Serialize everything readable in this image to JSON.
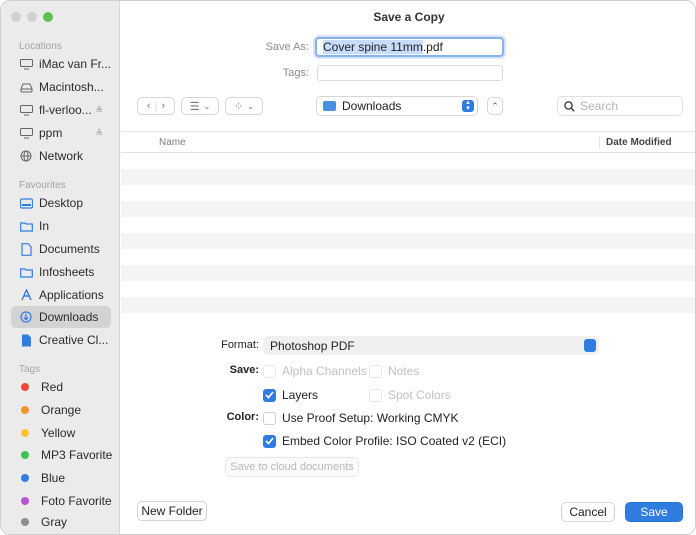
{
  "window": {
    "title": "Save a Copy"
  },
  "sidebar": {
    "locations_header": "Locations",
    "locations": [
      {
        "label": "iMac van Fr...",
        "icon": "display-icon"
      },
      {
        "label": "Macintosh...",
        "icon": "disk-icon"
      },
      {
        "label": "fl-verloo...",
        "icon": "display-icon",
        "eject": "≜"
      },
      {
        "label": "ppm",
        "icon": "display-icon",
        "eject": "≜"
      },
      {
        "label": "Network",
        "icon": "globe-icon"
      }
    ],
    "favourites_header": "Favourites",
    "favourites": [
      {
        "label": "Desktop",
        "icon": "desktop-icon"
      },
      {
        "label": "In",
        "icon": "folder-icon"
      },
      {
        "label": "Documents",
        "icon": "document-icon"
      },
      {
        "label": "Infosheets",
        "icon": "folder-icon"
      },
      {
        "label": "Applications",
        "icon": "applications-icon"
      },
      {
        "label": "Downloads",
        "icon": "download-icon",
        "selected": true
      },
      {
        "label": "Creative Cl...",
        "icon": "creative-cloud-file-icon"
      }
    ],
    "tags_header": "Tags",
    "tags": [
      {
        "label": "Red",
        "color": "#f0453a"
      },
      {
        "label": "Orange",
        "color": "#f5922f"
      },
      {
        "label": "Yellow",
        "color": "#f7c531"
      },
      {
        "label": "MP3 Favorite",
        "color": "#3cc251"
      },
      {
        "label": "Blue",
        "color": "#2f7de1"
      },
      {
        "label": "Foto Favorite",
        "color": "#b653d6"
      },
      {
        "label": "Gray",
        "color": "#8e8e8e"
      }
    ]
  },
  "save_as": {
    "label": "Save As:",
    "value_highlighted": "Cover spine 11mm",
    "value_rest": ".pdf"
  },
  "tags_field": {
    "label": "Tags:",
    "value": ""
  },
  "toolbar": {
    "location": "Downloads",
    "search_placeholder": "Search"
  },
  "list": {
    "col_name": "Name",
    "col_date": "Date Modified"
  },
  "options": {
    "format_label": "Format:",
    "format_value": "Photoshop PDF",
    "save_label": "Save:",
    "alpha_channels": "Alpha Channels",
    "notes": "Notes",
    "layers": "Layers",
    "spot_colors": "Spot Colors",
    "color_label": "Color:",
    "use_proof_setup": "Use Proof Setup:  Working CMYK",
    "embed_color_profile": "Embed Color Profile:  ISO Coated v2 (ECI)",
    "cloud_button": "Save to cloud documents"
  },
  "footer": {
    "new_folder": "New Folder",
    "cancel": "Cancel",
    "save": "Save"
  },
  "colors": {
    "accent": "#2f7de1"
  }
}
